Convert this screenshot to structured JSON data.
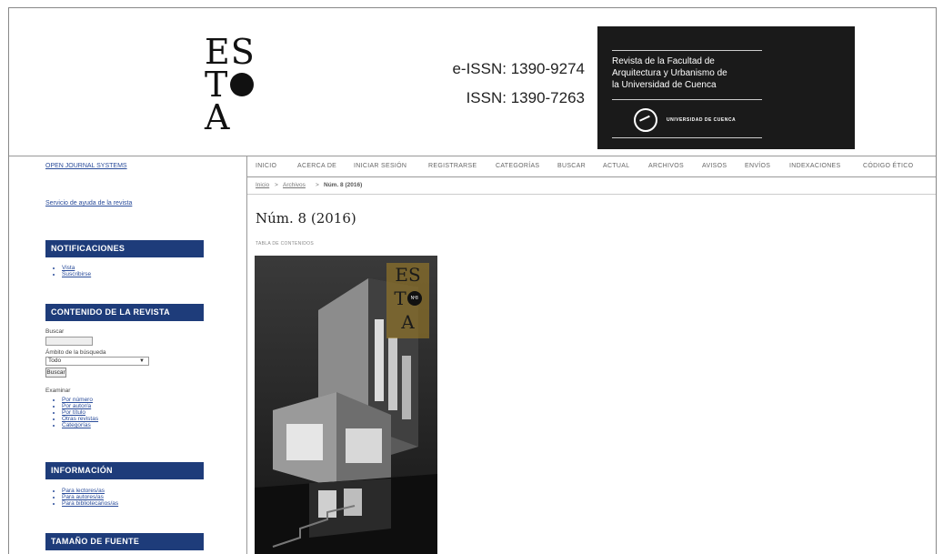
{
  "header": {
    "logo": {
      "row1": "ES",
      "row2": "T",
      "row3": "A"
    },
    "eissn": "e-ISSN: 1390-9274",
    "issn": "ISSN: 1390-7263",
    "journal_line1": "Revista de la Facultad de",
    "journal_line2": "Arquitectura y Urbanismo de",
    "journal_line3": "la Universidad de Cuenca",
    "univ_label": "UNIVERSIDAD DE CUENCA"
  },
  "sidebar": {
    "ojs_link": "OPEN JOURNAL SYSTEMS",
    "help_link": "Servicio de ayuda de la revista",
    "notif_title": "NOTIFICACIONES",
    "notif_items": [
      "Vista",
      "Suscribirse"
    ],
    "content_title": "CONTENIDO DE LA REVISTA",
    "search_label": "Buscar",
    "scope_label": "Ámbito de la búsqueda",
    "scope_value": "Todo",
    "search_button": "Buscar",
    "browse_label": "Examinar",
    "browse_items": [
      "Por número",
      "Por autor/a",
      "Por título",
      "Otras revistas",
      "Categorías"
    ],
    "info_title": "INFORMACIÓN",
    "info_items": [
      "Para lectores/as",
      "Para autores/as",
      "Para bibliotecarios/as"
    ],
    "font_title": "TAMAÑO DE FUENTE"
  },
  "nav": {
    "items": [
      "INICIO",
      "ACERCA DE",
      "INICIAR SESIÓN",
      "REGISTRARSE",
      "CATEGORÍAS",
      "BUSCAR",
      "ACTUAL",
      "ARCHIVOS",
      "AVISOS",
      "ENVÍOS",
      "INDEXACIONES",
      "CÓDIGO ÉTICO"
    ]
  },
  "breadcrumb": {
    "home": "Inicio",
    "sep1": ">",
    "archive": "Archivos",
    "sep2": ">",
    "current": "Núm. 8 (2016)"
  },
  "main": {
    "issue_title": "Núm. 8 (2016)",
    "toc_label": "TABLA DE CONTENIDOS"
  },
  "cover": {
    "logo_row1": "ES",
    "logo_row2": "T",
    "logo_dot": "Nº8",
    "logo_row3": "A"
  }
}
